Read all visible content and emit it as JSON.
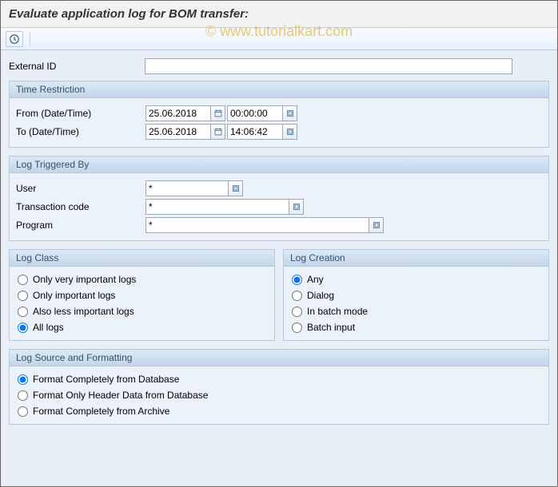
{
  "title": "Evaluate application log for BOM transfer:",
  "watermark": "© www.tutorialkart.com",
  "externalId": {
    "label": "External ID",
    "value": ""
  },
  "timeRestriction": {
    "title": "Time Restriction",
    "fromLabel": "From (Date/Time)",
    "toLabel": "To (Date/Time)",
    "fromDate": "25.06.2018",
    "fromTime": "00:00:00",
    "toDate": "25.06.2018",
    "toTime": "14:06:42"
  },
  "logTriggeredBy": {
    "title": "Log Triggered By",
    "userLabel": "User",
    "userValue": "*",
    "tcodeLabel": "Transaction code",
    "tcodeValue": "*",
    "programLabel": "Program",
    "programValue": "*"
  },
  "logClass": {
    "title": "Log Class",
    "options": [
      "Only very important logs",
      "Only important logs",
      "Also less important logs",
      "All logs"
    ],
    "selectedIndex": 3
  },
  "logCreation": {
    "title": "Log Creation",
    "options": [
      "Any",
      "Dialog",
      "In batch mode",
      "Batch input"
    ],
    "selectedIndex": 0
  },
  "logSource": {
    "title": "Log Source and Formatting",
    "options": [
      "Format Completely from Database",
      "Format Only Header Data from Database",
      "Format Completely from Archive"
    ],
    "selectedIndex": 0
  }
}
